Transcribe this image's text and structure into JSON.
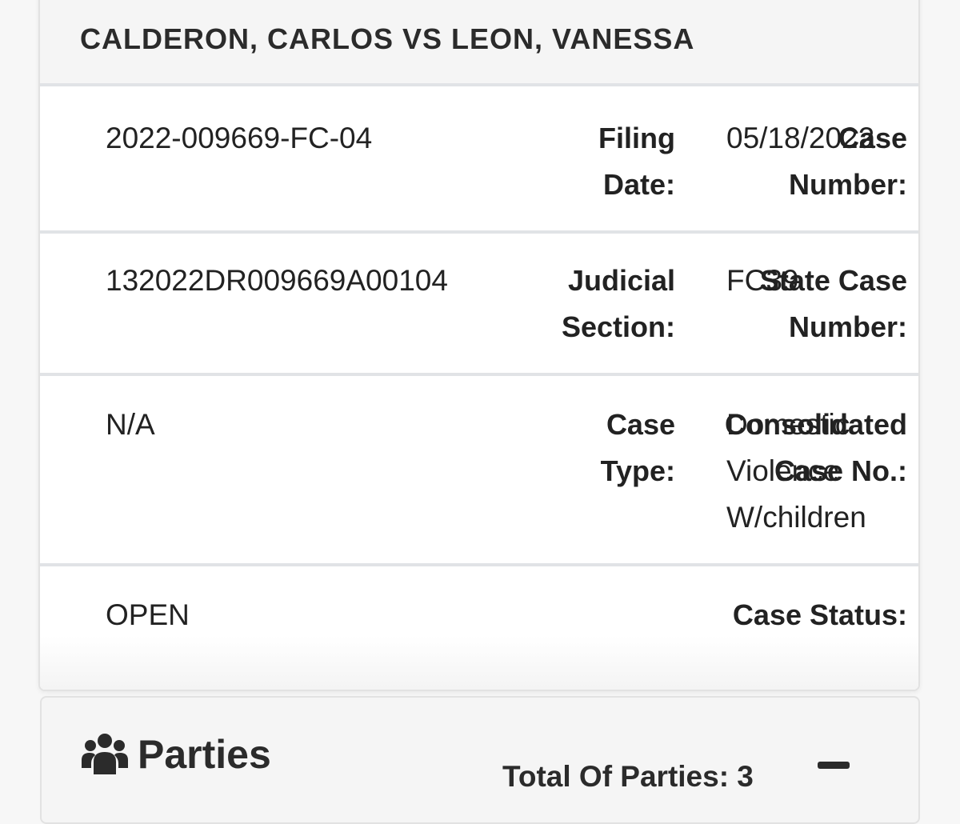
{
  "case": {
    "title": "CALDERON, CARLOS VS LEON, VANESSA"
  },
  "details": [
    {
      "left_label_line1": "Case",
      "left_label_line2": "Number:",
      "left_value": "2022-009669-FC-04",
      "right_label_line1": "Filing",
      "right_label_line2": "Date:",
      "right_value_lines": [
        "05/18/2022"
      ]
    },
    {
      "left_label_line1": "State Case",
      "left_label_line2": "Number:",
      "left_value": "132022DR009669A00104",
      "right_label_line1": "Judicial",
      "right_label_line2": "Section:",
      "right_value_lines": [
        "FC39"
      ]
    },
    {
      "left_label_line1": "Consolidated",
      "left_label_line2": "Case No.:",
      "left_value": "N/A",
      "right_label_line1": "Case",
      "right_label_line2": "Type:",
      "right_value_lines": [
        "Domestic",
        "Violence",
        "W/children"
      ]
    },
    {
      "left_label_line1": "Case Status:",
      "left_label_line2": "",
      "left_value": "OPEN"
    }
  ],
  "parties": {
    "icon": "users-icon",
    "title": "Parties",
    "total_label": "Total Of Parties: 3",
    "collapse_icon": "minus-icon"
  }
}
